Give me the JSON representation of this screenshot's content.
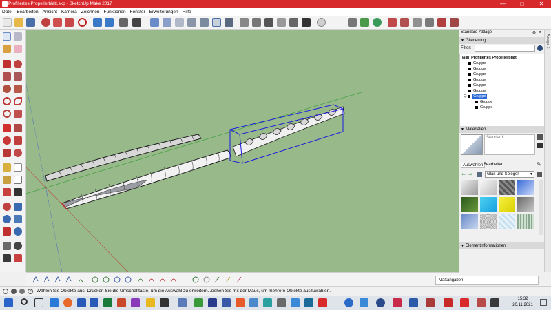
{
  "window": {
    "title": "Profiliertes Propellerblatt.skp - SketchUp Make 2017",
    "minimize": "—",
    "maximize": "□",
    "close": "✕"
  },
  "menu": [
    "Datei",
    "Bearbeiten",
    "Ansicht",
    "Kamera",
    "Zeichnen",
    "Funktionen",
    "Fenster",
    "Erweiterungen",
    "Hilfe"
  ],
  "tray": {
    "title": "Standard-Ablage",
    "tab_label": "Ablage 1",
    "outline": {
      "header": "Gliederung",
      "filter_label": "Filter:",
      "filter_value": "",
      "root": "Profiliertes Propellerblatt",
      "items": [
        "Gruppe",
        "Gruppe",
        "Gruppe",
        "Gruppe",
        "Gruppe",
        "Gruppe",
        "Gruppe"
      ],
      "selected": "Gruppe",
      "children": [
        "Gruppe",
        "Gruppe"
      ]
    },
    "materials": {
      "header": "Materialien",
      "current": "Standard",
      "tab_select": "Auswählen",
      "tab_edit": "Bearbeiten",
      "library": "Glas und Spiegel"
    },
    "entity": {
      "header": "Elementinformationen"
    }
  },
  "measure": {
    "label": "Maßangaben",
    "value": ""
  },
  "status": {
    "text": "Wählen Sie Objekte aus. Drücken Sie die Umschalttaste, um die Auswahl zu erweitern. Ziehen Sie mit der Maus, um mehrere Objekte auszuwählen."
  },
  "taskbar": {
    "time": "15:32",
    "date": "20.11.2021"
  },
  "colors": {
    "titlebar": "#d7282b",
    "viewport": "#98b98a",
    "selection": "#1a1adf",
    "axis_red": "#b84a3a",
    "axis_green": "#2f9a2f",
    "axis_blue": "#4a6bc0"
  }
}
